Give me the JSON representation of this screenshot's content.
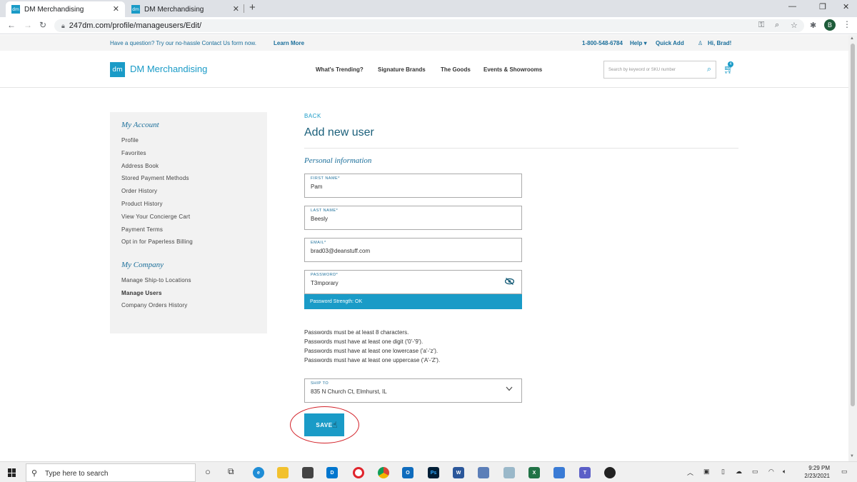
{
  "browser": {
    "tabs": [
      {
        "title": "DM Merchandising",
        "favicon": "dm"
      },
      {
        "title": "DM Merchandising",
        "favicon": "dm"
      }
    ],
    "url": "247dm.com/profile/manageusers/Edit/",
    "profile_initial": "B"
  },
  "infobar": {
    "message": "Have a question? Try our no-hassle Contact Us form now.",
    "learn_more": "Learn More",
    "phone": "1-800-548-6784",
    "help": "Help",
    "quick_add": "Quick Add",
    "greeting": "Hi, Brad!"
  },
  "header": {
    "logo_mark": "dm",
    "logo_text": "DM Merchandising",
    "nav": [
      "What's Trending?",
      "Signature Brands",
      "The Goods",
      "Events & Showrooms"
    ],
    "search_placeholder": "Search by keyword or SKU number",
    "cart_count": "4"
  },
  "sidebar": {
    "account_heading": "My Account",
    "account_items": [
      "Profile",
      "Favorites",
      "Address Book",
      "Stored Payment Methods",
      "Order History",
      "Product History",
      "View Your Concierge Cart",
      "Payment Terms",
      "Opt in for Paperless Billing"
    ],
    "company_heading": "My Company",
    "company_items": [
      "Manage Ship-to Locations",
      "Manage Users",
      "Company Orders History"
    ],
    "active_item": "Manage Users"
  },
  "main": {
    "back": "BACK",
    "title": "Add new user",
    "section": "Personal information",
    "fields": {
      "first_name": {
        "label": "FIRST NAME*",
        "value": "Pam"
      },
      "last_name": {
        "label": "LAST NAME*",
        "value": "Beesly"
      },
      "email": {
        "label": "EMAIL*",
        "value": "brad03@deanstuff.com"
      },
      "password": {
        "label": "PASSWORD*",
        "value": "T3mporary"
      },
      "ship_to": {
        "label": "SHIP TO",
        "value": "835 N Church Ct, Elmhurst, IL"
      }
    },
    "password_strength": "Password Strength: OK",
    "rules": [
      "Passwords must be at least 8 characters.",
      "Passwords must have at least one digit ('0'-'9').",
      "Passwords must have at least one lowercase ('a'-'z').",
      "Passwords must have at least one uppercase ('A'-'Z')."
    ],
    "save": "SAVE"
  },
  "taskbar": {
    "search_placeholder": "Type here to search",
    "time": "9:29 PM",
    "date": "2/23/2021"
  },
  "colors": {
    "accent": "#1a9bc7",
    "heading": "#1a5f7a",
    "annotation": "#d3232a"
  }
}
